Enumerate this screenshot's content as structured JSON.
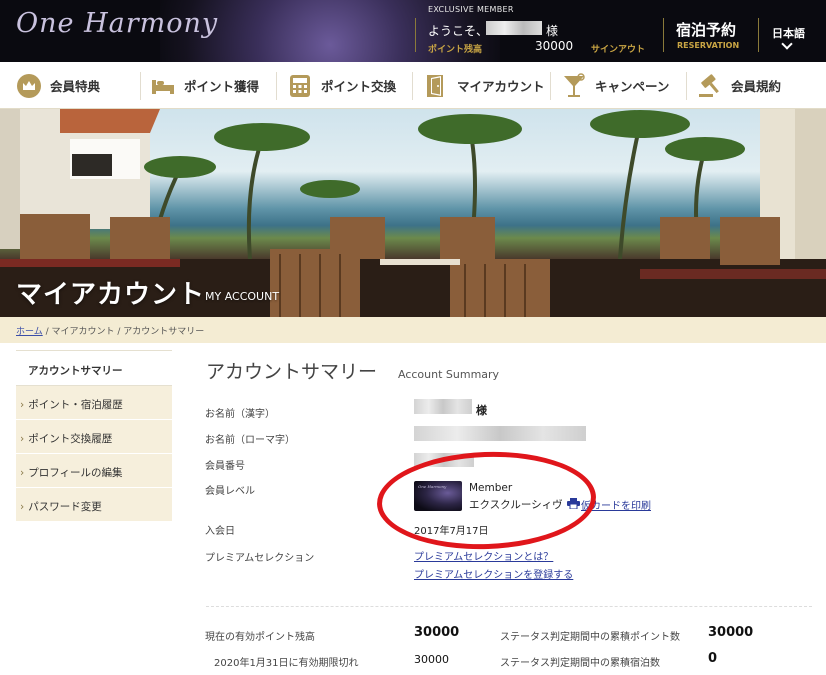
{
  "header": {
    "logo": "One Harmony",
    "exclusive_label": "EXCLUSIVE MEMBER",
    "welcome": "ようこそ、",
    "honorific": "様",
    "points_label": "ポイント残高",
    "points_value": "30000",
    "signout": "サインアウト",
    "reservation_title": "宿泊予約",
    "reservation_sub": "RESERVATION",
    "language": "日本語"
  },
  "nav": {
    "items": [
      {
        "label": "会員特典",
        "icon": "crown-icon"
      },
      {
        "label": "ポイント獲得",
        "icon": "bed-icon"
      },
      {
        "label": "ポイント交換",
        "icon": "calculator-icon"
      },
      {
        "label": "マイアカウント",
        "icon": "door-icon"
      },
      {
        "label": "キャンペーン",
        "icon": "cocktail-icon"
      },
      {
        "label": "会員規約",
        "icon": "gavel-icon"
      }
    ]
  },
  "hero": {
    "title": "マイアカウント",
    "subtitle": "MY ACCOUNT"
  },
  "breadcrumb": {
    "home": "ホーム",
    "sep": " / ",
    "level2": "マイアカウント",
    "level3": "アカウントサマリー"
  },
  "sidebar": {
    "active": "アカウントサマリー",
    "items": [
      {
        "label": "ポイント・宿泊履歴"
      },
      {
        "label": "ポイント交換履歴"
      },
      {
        "label": "プロフィールの編集"
      },
      {
        "label": "パスワード変更"
      }
    ]
  },
  "main": {
    "title": "アカウントサマリー",
    "title_en": "Account Summary",
    "name_kanji_label": "お名前（漢字）",
    "name_kanji_suffix": "様",
    "name_roman_label": "お名前（ローマ字）",
    "member_no_label": "会員番号",
    "level_label": "会員レベル",
    "level_en": "Member",
    "level_ja": "エクスクルーシィヴ",
    "print_card": "仮カードを印刷",
    "join_label": "入会日",
    "join_date": "2017年7月17日",
    "premium_label": "プレミアムセレクション",
    "premium_link1": "プレミアムセレクションとは？",
    "premium_link2": "プレミアムセレクションを登録する"
  },
  "summary": {
    "balance_label": "現在の有効ポイント残高",
    "balance_value": "30000",
    "status_points_label": "ステータス判定期間中の累積ポイント数",
    "status_points_value": "30000",
    "expiry_label": "2020年1月31日に有効期限切れ",
    "expiry_value": "30000",
    "status_nights_label": "ステータス判定期間中の累積宿泊数",
    "status_nights_value": "0"
  },
  "colors": {
    "accent_gold": "#c9a544",
    "link_blue": "#2a3a9a",
    "annotation_red": "#e0161b",
    "sidebar_bg": "#f6efdc"
  }
}
